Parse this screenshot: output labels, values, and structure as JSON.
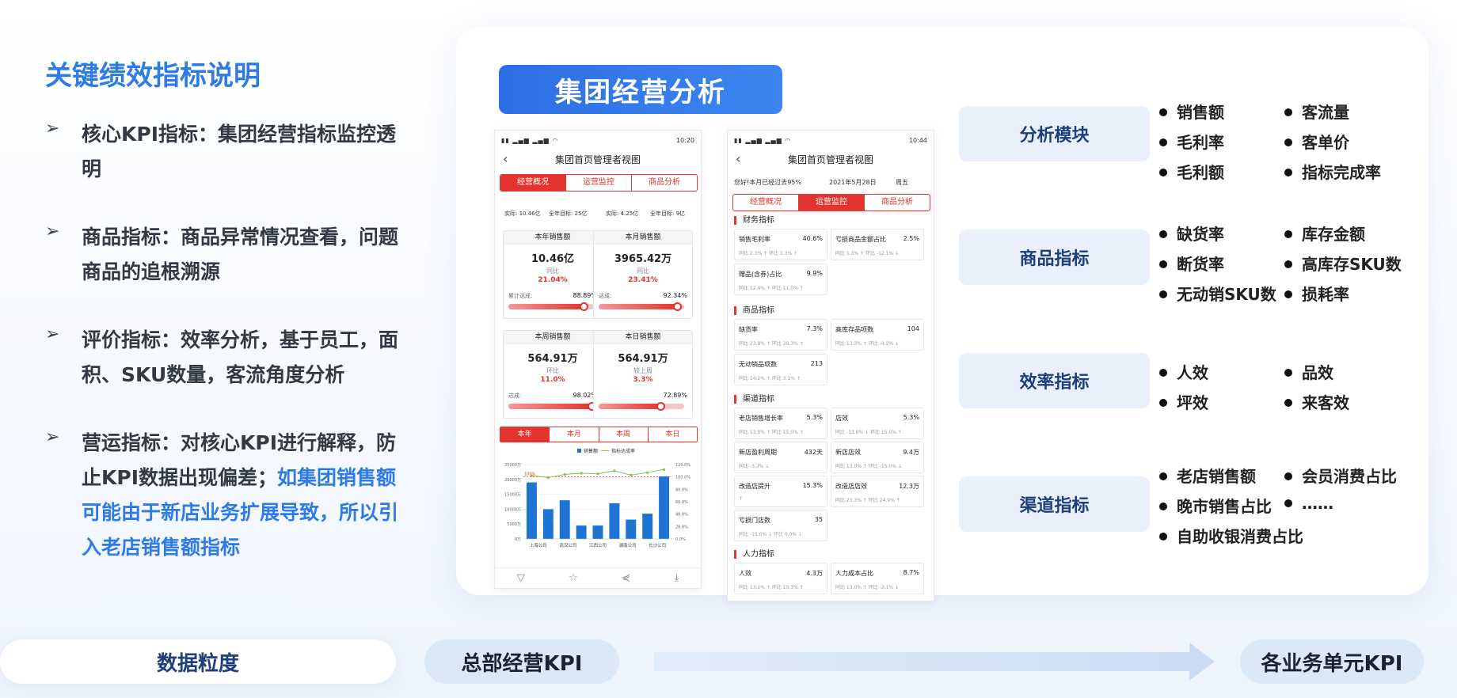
{
  "left": {
    "title": "关键绩效指标说明",
    "items": [
      {
        "arrow": "➢",
        "text": "核心KPI指标：集团经营指标监控透明"
      },
      {
        "arrow": "➢",
        "text": "商品指标：商品异常情况查看，问题商品的追根溯源"
      },
      {
        "arrow": "➢",
        "text": "评价指标：效率分析，基于员工，面积、SKU数量，客流角度分析"
      },
      {
        "arrow": "➢",
        "text": "营运指标：对核心KPI进行解释，防止KPI数据出现偏差；",
        "highlight": "如集团销售额可能由于新店业务扩展导致，所以引入老店销售额指标"
      }
    ]
  },
  "card": {
    "title": "集团经营分析"
  },
  "phone1": {
    "time": "10:20",
    "nav_title": "集团首页管理者视图",
    "tabs": [
      "经营概况",
      "运营监控",
      "商品分析"
    ],
    "summary": [
      "实际: 10.46亿",
      "全年目标: 25亿",
      "实际: 4.25亿",
      "全年目标: 9亿"
    ],
    "boxes": [
      {
        "title": "本年销售额",
        "value": "10.46亿",
        "label": "同比",
        "pct": "21.04%",
        "rate_label": "累计达成:",
        "rate": "88.89%",
        "progress": 0.8889
      },
      {
        "title": "本月销售额",
        "value": "3965.42万",
        "label": "同比",
        "pct": "23.41%",
        "rate_label": "达成:",
        "rate": "92.34%",
        "progress": 0.9234
      },
      {
        "title": "本周销售额",
        "value": "564.91万",
        "label": "环比",
        "pct": "11.0%",
        "rate_label": "达成:",
        "rate": "98.02%",
        "progress": 0.9802
      },
      {
        "title": "本日销售额",
        "value": "564.91万",
        "label": "较上周",
        "pct": "3.3%",
        "rate_label": "",
        "rate": "72.89%",
        "progress": 0.7289
      }
    ],
    "period_tabs": [
      "本年",
      "本月",
      "本周",
      "本日"
    ],
    "footer_icons": [
      "filter-icon",
      "star-icon",
      "share-icon",
      "download-icon"
    ]
  },
  "chart_data": {
    "type": "bar",
    "categories": [
      "上海公司",
      "武汉公司",
      "江西公司",
      "湖南公司",
      "长沙公司"
    ],
    "series": [
      {
        "name": "销售额",
        "values": [
          19000,
          10000,
          13000,
          4500,
          4500,
          12000,
          6500,
          8500,
          21000
        ]
      },
      {
        "name": "指标达成率",
        "values": [
          102,
          99,
          104,
          106,
          105,
          110,
          103,
          107,
          112
        ]
      }
    ],
    "ylim_left": [
      0,
      25000
    ],
    "ylim_right": [
      0,
      120
    ],
    "yticks_left": [
      "25000万",
      "20000万",
      "15000万",
      "10000万",
      "5000万",
      "0万"
    ],
    "yticks_right": [
      "120.0%",
      "100.0%",
      "80.0%",
      "60.0%",
      "40.0%",
      "20.0%",
      "0.0%"
    ],
    "ref_label": "100%",
    "bar_color": "#1e74d2",
    "line_color": "#8bc34a"
  },
  "phone2": {
    "time": "10:44",
    "nav_title": "集团首页管理者视图",
    "greeting": "您好!本月已经过去95%",
    "date": "2021年5月28日",
    "weekday": "周五",
    "tabs": [
      "经营概况",
      "运营监控",
      "商品分析"
    ],
    "sections": [
      {
        "title": "财务指标",
        "cells": [
          {
            "name": "销售毛利率",
            "value": "40.6%",
            "sub": "同比 2.3% ↑  环比 1.3% ↑"
          },
          {
            "name": "亏损商品金额占比",
            "value": "2.5%",
            "sub": "同比 1.3% ↑  环比 -12.1% ↓"
          },
          {
            "name": "赠品(含券)占比",
            "value": "9.9%",
            "sub": "同比 12.4% ↑  环比 11.0% ↑"
          }
        ]
      },
      {
        "title": "商品指标",
        "cells": [
          {
            "name": "缺货率",
            "value": "7.3%",
            "sub": "同比 23.9% ↑  环比 29.3% ↑"
          },
          {
            "name": "高库存品项数",
            "value": "104",
            "sub": "同比 13.3% ↑  环比 -4.2% ↓"
          },
          {
            "name": "无动销品项数",
            "value": "213",
            "sub": "同比 14.2% ↑  环比 3.1% ↑"
          }
        ]
      },
      {
        "title": "渠道指标",
        "cells": [
          {
            "name": "老店销售增长率",
            "value": "5.3%",
            "sub": "同比 13.0% ↑  环比 15.0% ↑"
          },
          {
            "name": "店效",
            "value": "5.3%",
            "sub": "同比 -13.0% ↓  环比 15.0% ↑"
          },
          {
            "name": "新店盈利周期",
            "value": "432天",
            "sub": "同比 -3.3% ↓"
          },
          {
            "name": "新店店效",
            "value": "9.4万",
            "sub": "同比 13.0% ↑  环比 -15.0% ↓"
          },
          {
            "name": "改造店提升",
            "value": "15.3%",
            "sub": "↑"
          },
          {
            "name": "改造店店效",
            "value": "12.3万",
            "sub": "同比 23.3% ↑  环比 24.9% ↑"
          },
          {
            "name": "亏损门店数",
            "value": "35",
            "sub": "同比 -15.0% ↓  环比 0.0% ↓"
          }
        ]
      },
      {
        "title": "人力指标",
        "cells": [
          {
            "name": "人效",
            "value": "4.3万",
            "sub": "同比 13.2% ↑  环比 15.3% ↑"
          },
          {
            "name": "人力成本占比",
            "value": "8.7%",
            "sub": "同比 13.0% ↑  环比 -2.1% ↓"
          }
        ]
      }
    ]
  },
  "modules": [
    {
      "name": "分析模块",
      "bullets": [
        "销售额",
        "客流量",
        "毛利率",
        "客单价",
        "毛利额",
        "指标完成率"
      ]
    },
    {
      "name": "商品指标",
      "bullets": [
        "缺货率",
        "库存金额",
        "断货率",
        "高库存SKU数",
        "无动销SKU数",
        "损耗率"
      ]
    },
    {
      "name": "效率指标",
      "bullets": [
        "人效",
        "品效",
        "坪效",
        "来客效"
      ]
    },
    {
      "name": "渠道指标",
      "bullets": [
        "老店销售额",
        "会员消费占比",
        "晚市销售占比",
        "……",
        "自助收银消费占比"
      ]
    }
  ],
  "bottom": {
    "granularity": "数据粒度",
    "hq": "总部经营KPI",
    "units": "各业务单元KPI"
  }
}
